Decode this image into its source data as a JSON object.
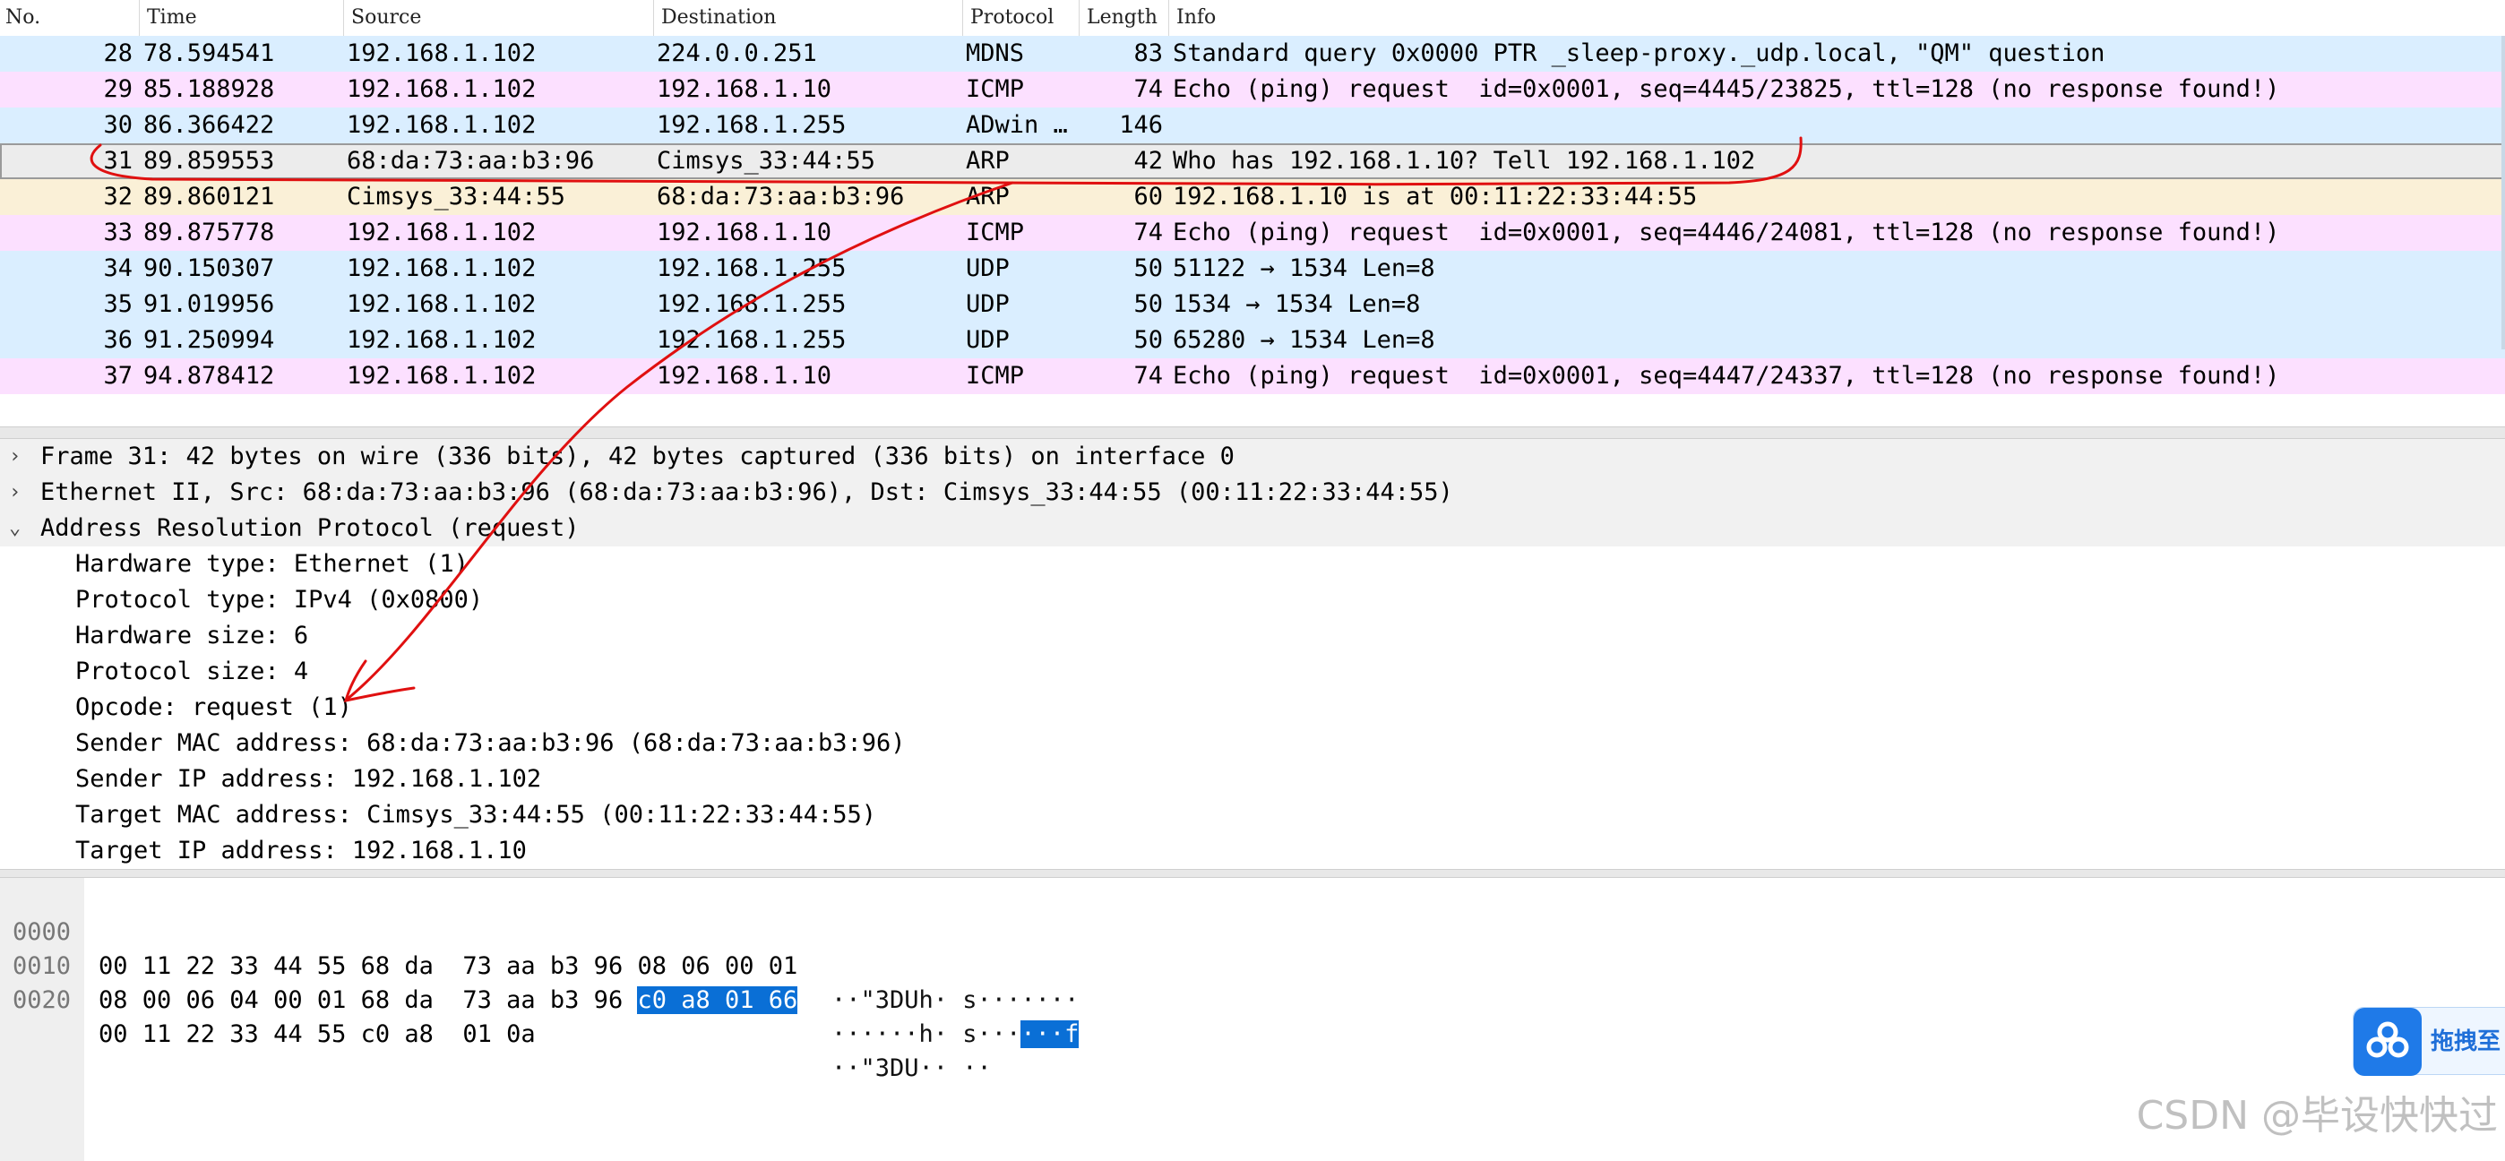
{
  "columns": {
    "no": "No.",
    "time": "Time",
    "source": "Source",
    "destination": "Destination",
    "protocol": "Protocol",
    "length": "Length",
    "info": "Info"
  },
  "packets": [
    {
      "no": "28",
      "time": "78.594541",
      "source": "192.168.1.102",
      "destination": "224.0.0.251",
      "protocol": "MDNS",
      "length": "83",
      "info": "Standard query 0x0000 PTR _sleep-proxy._udp.local, \"QM\" question"
    },
    {
      "no": "29",
      "time": "85.188928",
      "source": "192.168.1.102",
      "destination": "192.168.1.10",
      "protocol": "ICMP",
      "length": "74",
      "info": "Echo (ping) request  id=0x0001, seq=4445/23825, ttl=128 (no response found!)"
    },
    {
      "no": "30",
      "time": "86.366422",
      "source": "192.168.1.102",
      "destination": "192.168.1.255",
      "protocol": "ADwin …",
      "length": "146",
      "info": ""
    },
    {
      "no": "31",
      "time": "89.859553",
      "source": "68:da:73:aa:b3:96",
      "destination": "Cimsys_33:44:55",
      "protocol": "ARP",
      "length": "42",
      "info": "Who has 192.168.1.10? Tell 192.168.1.102"
    },
    {
      "no": "32",
      "time": "89.860121",
      "source": "Cimsys_33:44:55",
      "destination": "68:da:73:aa:b3:96",
      "protocol": "ARP",
      "length": "60",
      "info": "192.168.1.10 is at 00:11:22:33:44:55"
    },
    {
      "no": "33",
      "time": "89.875778",
      "source": "192.168.1.102",
      "destination": "192.168.1.10",
      "protocol": "ICMP",
      "length": "74",
      "info": "Echo (ping) request  id=0x0001, seq=4446/24081, ttl=128 (no response found!)"
    },
    {
      "no": "34",
      "time": "90.150307",
      "source": "192.168.1.102",
      "destination": "192.168.1.255",
      "protocol": "UDP",
      "length": "50",
      "info": "51122 → 1534 Len=8"
    },
    {
      "no": "35",
      "time": "91.019956",
      "source": "192.168.1.102",
      "destination": "192.168.1.255",
      "protocol": "UDP",
      "length": "50",
      "info": "1534 → 1534 Len=8"
    },
    {
      "no": "36",
      "time": "91.250994",
      "source": "192.168.1.102",
      "destination": "192.168.1.255",
      "protocol": "UDP",
      "length": "50",
      "info": "65280 → 1534 Len=8"
    },
    {
      "no": "37",
      "time": "94.878412",
      "source": "192.168.1.102",
      "destination": "192.168.1.10",
      "protocol": "ICMP",
      "length": "74",
      "info": "Echo (ping) request  id=0x0001, seq=4447/24337, ttl=128 (no response found!)"
    }
  ],
  "details": {
    "frame": "Frame 31: 42 bytes on wire (336 bits), 42 bytes captured (336 bits) on interface 0",
    "ethernet": "Ethernet II, Src: 68:da:73:aa:b3:96 (68:da:73:aa:b3:96), Dst: Cimsys_33:44:55 (00:11:22:33:44:55)",
    "arp": "Address Resolution Protocol (request)",
    "arp_fields": [
      "Hardware type: Ethernet (1)",
      "Protocol type: IPv4 (0x0800)",
      "Hardware size: 6",
      "Protocol size: 4",
      "Opcode: request (1)",
      "Sender MAC address: 68:da:73:aa:b3:96 (68:da:73:aa:b3:96)",
      "Sender IP address: 192.168.1.102",
      "Target MAC address: Cimsys_33:44:55 (00:11:22:33:44:55)",
      "Target IP address: 192.168.1.10"
    ],
    "arrow_collapsed": "›",
    "arrow_expanded": "⌄"
  },
  "bytes": [
    {
      "offset": "0000",
      "hex": "00 11 22 33 44 55 68 da  73 aa b3 96 08 06 00 01",
      "hex_hl": "",
      "ascii": "··\"3DUh· s·······",
      "ascii_hl": ""
    },
    {
      "offset": "0010",
      "hex": "08 00 06 04 00 01 68 da  73 aa b3 96 ",
      "hex_hl": "c0 a8 01 66",
      "ascii": "······h· s···",
      "ascii_hl": "···f"
    },
    {
      "offset": "0020",
      "hex": "00 11 22 33 44 55 c0 a8  01 0a",
      "hex_hl": "",
      "ascii": "··\"3DU·· ··",
      "ascii_hl": ""
    }
  ],
  "overlay": {
    "baidu_label": "拖拽至",
    "watermark": "CSDN @毕设快快过"
  },
  "colors": {
    "udp_row": "#daeeff",
    "icmp_row": "#fce0ff",
    "arp_row": "#faf0d7",
    "selected_row": "#ececec",
    "byte_highlight": "#0a6fd6",
    "annotation": "#e01010"
  }
}
